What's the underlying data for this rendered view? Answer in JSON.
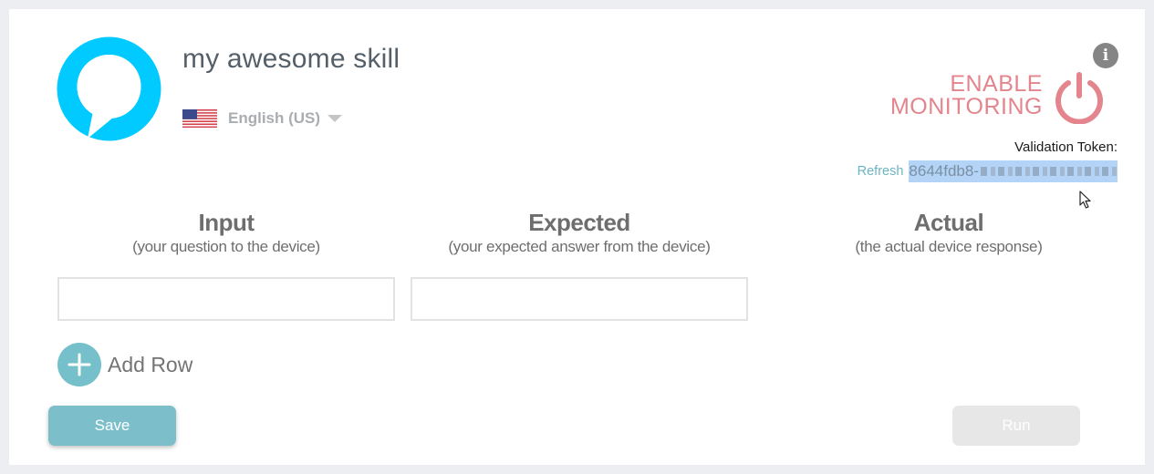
{
  "skill": {
    "title": "my awesome skill",
    "language": "English (US)"
  },
  "monitoring": {
    "line1": "ENABLE",
    "line2": "MONITORING",
    "token_label": "Validation Token:",
    "refresh_label": "Refresh",
    "token_value": "8644fdb8-"
  },
  "columns": [
    {
      "title": "Input",
      "subtitle": "(your question to the device)"
    },
    {
      "title": "Expected",
      "subtitle": "(your expected answer from the device)"
    },
    {
      "title": "Actual",
      "subtitle": "(the actual device response)"
    }
  ],
  "rows": [
    {
      "input": "",
      "expected": ""
    }
  ],
  "actions": {
    "add_row": "Add Row",
    "save": "Save",
    "run": "Run"
  },
  "icons": {
    "logo": "alexa-logo-icon",
    "flag": "us-flag-icon",
    "info": "info-icon",
    "power": "power-icon",
    "add": "plus-icon"
  },
  "colors": {
    "accent": "#76c0cb",
    "monitor": "#e4848d",
    "alexa_blue": "#00caff"
  }
}
